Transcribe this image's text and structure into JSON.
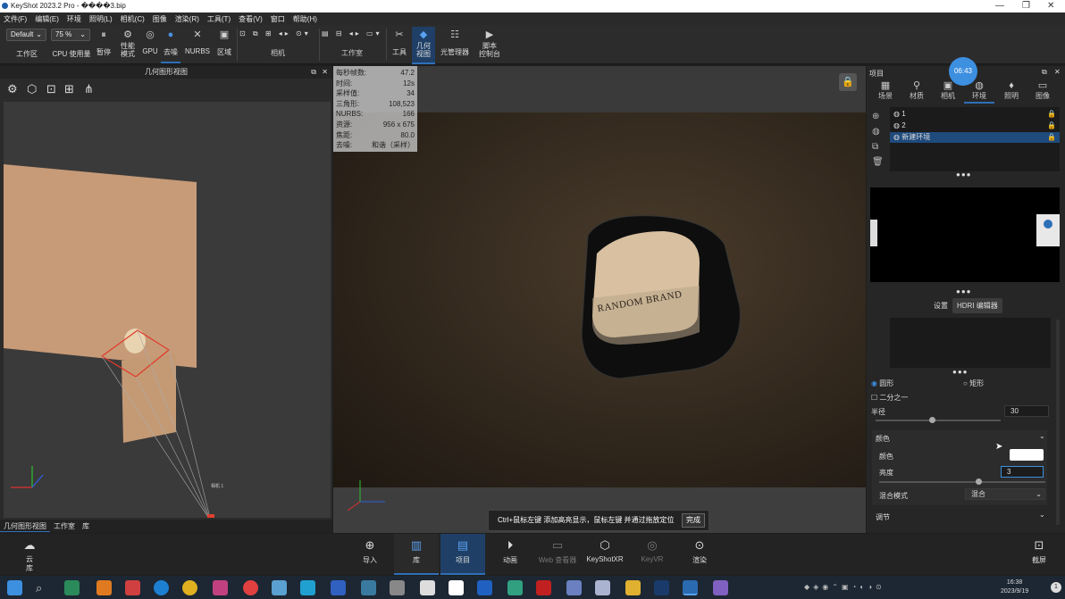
{
  "window": {
    "title": "KeyShot 2023.2 Pro - ����3.bip",
    "controls": [
      "—",
      "❐",
      "✕"
    ]
  },
  "menu": [
    "文件(F)",
    "编辑(E)",
    "环境",
    "照明(L)",
    "相机(C)",
    "图像",
    "渲染(R)",
    "工具(T)",
    "查看(V)",
    "窗口",
    "帮助(H)"
  ],
  "ribbon": {
    "workspace_select": "Default",
    "zoom_select": "75 %",
    "workspace_label": "工作区",
    "cpu_label": "CPU 使用量",
    "pause_label": "暂停",
    "perf_mode_label": "性能\n模式",
    "gpu_label": "GPU",
    "denoise_label": "去噪",
    "nurbs_label": "NURBS",
    "region_label": "区域",
    "camera_group_label": "相机",
    "studio_group_label": "工作室",
    "tools_label": "工具",
    "geometry_view_label": "几何\n视图",
    "light_manager_label": "光管理器",
    "script_console_label": "脚本\n控制台"
  },
  "left_panel": {
    "title": "几何图形视图",
    "tabs": [
      "几何图形视图",
      "工作室",
      "库"
    ],
    "camera_label": "相机 1"
  },
  "viewport": {
    "stats": [
      [
        "每秒帧数:",
        "47.2"
      ],
      [
        "时间:",
        "12s"
      ],
      [
        "采样值:",
        "34"
      ],
      [
        "三角形:",
        "108,523"
      ],
      [
        "NURBS:",
        "166"
      ],
      [
        "资源:",
        "956 x 675"
      ],
      [
        "焦距:",
        "80.0"
      ],
      [
        "去噪:",
        "和谐（采样）"
      ]
    ],
    "jar_text": "RANDOM BRAND",
    "hint": "Ctrl+鼠标左键 添加高亮显示，鼠标左键 并通过拖放定位",
    "hint_button": "完成"
  },
  "right_panel": {
    "title": "项目",
    "timer_badge": "06:43",
    "tabs": [
      "场景",
      "材质",
      "相机",
      "环境",
      "照明",
      "图像"
    ],
    "active_tab": "环境",
    "environments": [
      "1",
      "2",
      "新建环境"
    ],
    "sub_tabs": [
      "设置",
      "HDRI 编辑器"
    ],
    "shape_options": {
      "circle": "圆形",
      "rect": "矩形"
    },
    "half_label": "二分之一",
    "radius_label": "半径",
    "radius_value": "30",
    "color_section": "颜色",
    "color_label": "颜色",
    "brightness_label": "亮度",
    "brightness_value": "3",
    "blend_label": "混合模式",
    "blend_value": "混合",
    "adjust_section": "调节"
  },
  "bottombar": {
    "cloud_label": "云\n库",
    "items": [
      "导入",
      "库",
      "项目",
      "动画",
      "Web 查看器",
      "KeyShotXR",
      "KeyVR",
      "渲染"
    ],
    "screenshot_label": "截屏"
  },
  "taskbar": {
    "time": "16:38",
    "date": "2023/9/19",
    "notification": "1"
  },
  "colors": {
    "accent": "#2f6fb8",
    "timer": "#3d8fe0",
    "background": "#1e1e1e"
  }
}
